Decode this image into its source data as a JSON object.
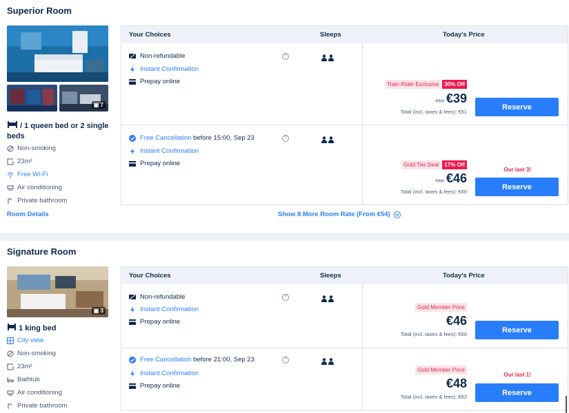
{
  "colors": {
    "accent": "#287dfa",
    "promo": "#f0174f",
    "text": "#0f294d"
  },
  "table_headers": {
    "choices": "Your Choices",
    "sleeps": "Sleeps",
    "price": "Today's Price"
  },
  "rooms": [
    {
      "title": "Superior Room",
      "photo_count": "7",
      "bed": "/ 1 queen bed or 2 single beds",
      "amenities": [
        {
          "label": "Non-smoking",
          "icon": "no-smoking-icon"
        },
        {
          "label": "23m²",
          "icon": "room-size-icon"
        },
        {
          "label": "Free Wi-Fi",
          "icon": "wifi-icon"
        },
        {
          "label": "Air conditioning",
          "icon": "air-conditioning-icon"
        },
        {
          "label": "Private bathroom",
          "icon": "shower-icon"
        }
      ],
      "details_link": "Room Details",
      "rates": [
        {
          "policy": "Non-refundable",
          "confirmation": "Instant Confirmation",
          "payment": "Prepay online",
          "promo_label": "Train Rider Exclusive",
          "discount": "30% Off",
          "old_price": "€59",
          "price": "€39",
          "total": "Total (incl. taxes & fees): €51",
          "reserve": "Reserve",
          "availability": ""
        },
        {
          "policy": "Free Cancellation",
          "policy_detail": " before 15:00, Sep 23",
          "confirmation": "Instant Confirmation",
          "payment": "Prepay online",
          "promo_label": "Gold Tier Deal",
          "discount": "17% Off",
          "old_price": "€58",
          "price": "€46",
          "total": "Total (incl. taxes & fees): €60",
          "reserve": "Reserve",
          "availability": "Our last 3!"
        }
      ],
      "show_more": "Show 8 More Room Rate (From €54)"
    },
    {
      "title": "Signature Room",
      "photo_count": "3",
      "bed": "1 king bed",
      "view": "City view",
      "amenities": [
        {
          "label": "Non-smoking",
          "icon": "no-smoking-icon"
        },
        {
          "label": "23m²",
          "icon": "room-size-icon"
        },
        {
          "label": "Bathtub",
          "icon": "bathtub-icon"
        },
        {
          "label": "Air conditioning",
          "icon": "air-conditioning-icon"
        },
        {
          "label": "Private bathroom",
          "icon": "shower-icon"
        }
      ],
      "rates": [
        {
          "policy": "Non-refundable",
          "confirmation": "Instant Confirmation",
          "payment": "Prepay online",
          "promo_label": "Gold Member Price",
          "price": "€46",
          "total": "Total (incl. taxes & fees): €60",
          "reserve": "Reserve",
          "availability": ""
        },
        {
          "policy": "Free Cancellation",
          "policy_detail": " before 21:00, Sep 23",
          "confirmation": "Instant Confirmation",
          "payment": "Prepay online",
          "promo_label": "Gold Member Price",
          "price": "€48",
          "total": "Total (incl. taxes & fees): €62",
          "reserve": "Reserve",
          "availability": "Our last 1!"
        }
      ]
    }
  ]
}
